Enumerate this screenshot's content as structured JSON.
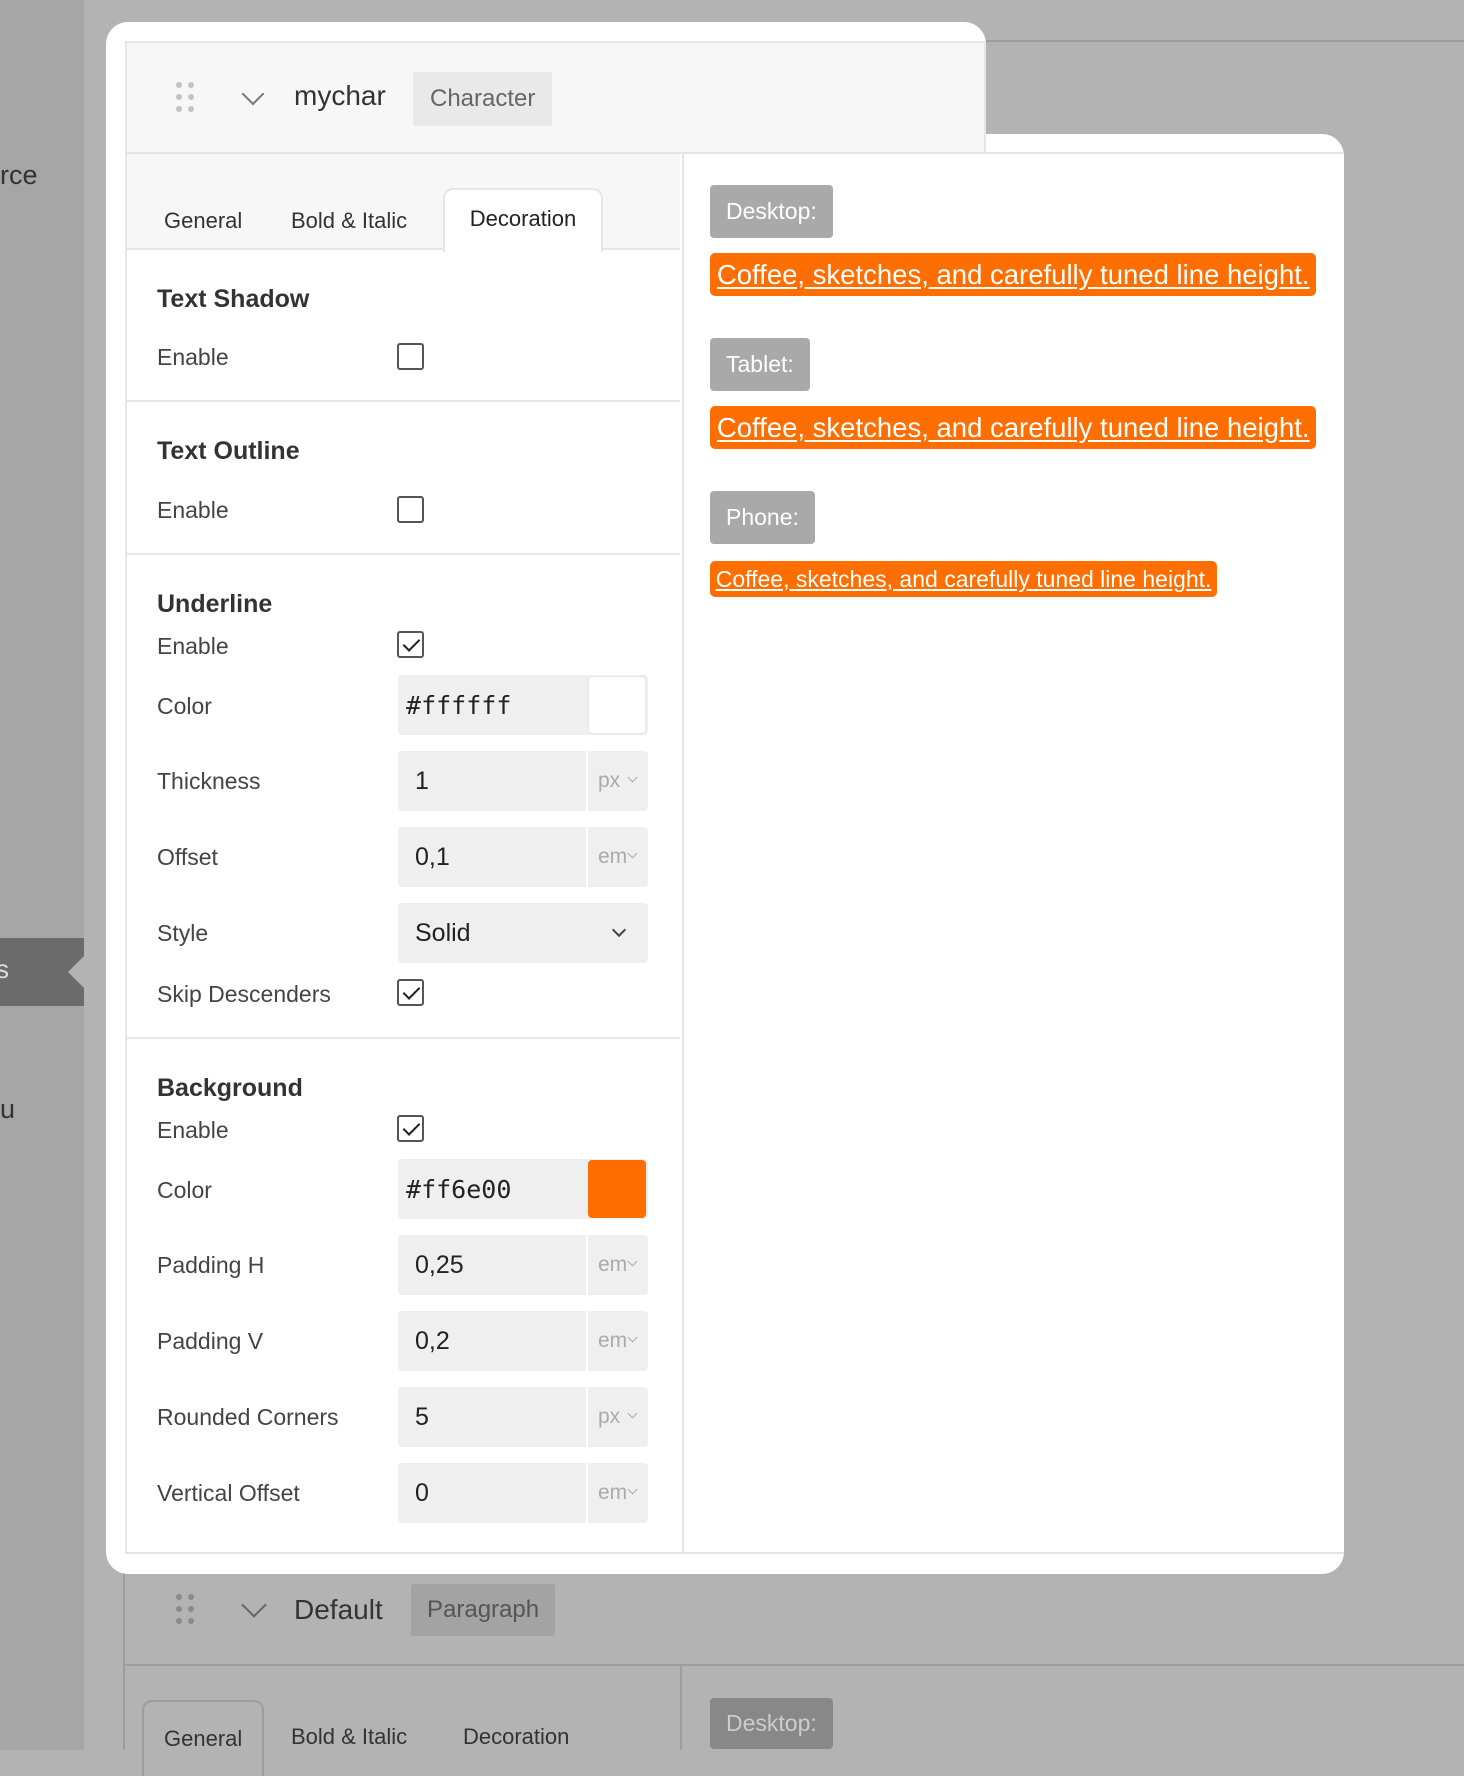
{
  "background_page": {
    "sidebar_fragments": [
      "rce",
      "s",
      "u"
    ],
    "next_item": {
      "title": "Default",
      "badge": "Paragraph"
    },
    "next_tabs": [
      "General",
      "Bold & Italic",
      "Decoration"
    ],
    "next_device_label": "Desktop:"
  },
  "style_item": {
    "title": "mychar",
    "badge": "Character"
  },
  "tabs": [
    "General",
    "Bold & Italic",
    "Decoration"
  ],
  "active_tab": "Decoration",
  "text_shadow": {
    "title": "Text Shadow",
    "enable_label": "Enable",
    "enabled": false
  },
  "text_outline": {
    "title": "Text Outline",
    "enable_label": "Enable",
    "enabled": false
  },
  "underline": {
    "title": "Underline",
    "enable_label": "Enable",
    "enabled": true,
    "color_label": "Color",
    "color_value": "ffffff",
    "color_hex": "#ffffff",
    "thickness_label": "Thickness",
    "thickness_value": "1",
    "thickness_unit": "px",
    "offset_label": "Offset",
    "offset_value": "0,1",
    "offset_unit": "em",
    "style_label": "Style",
    "style_value": "Solid",
    "skip_label": "Skip Descenders",
    "skip_enabled": true
  },
  "background": {
    "title": "Background",
    "enable_label": "Enable",
    "enabled": true,
    "color_label": "Color",
    "color_value": "ff6e00",
    "color_hex": "#ff6e00",
    "padding_h_label": "Padding H",
    "padding_h_value": "0,25",
    "padding_h_unit": "em",
    "padding_v_label": "Padding V",
    "padding_v_value": "0,2",
    "padding_v_unit": "em",
    "corners_label": "Rounded Corners",
    "corners_value": "5",
    "corners_unit": "px",
    "voffset_label": "Vertical Offset",
    "voffset_value": "0",
    "voffset_unit": "em"
  },
  "preview": {
    "desktop_label": "Desktop:",
    "tablet_label": "Tablet:",
    "phone_label": "Phone:",
    "sample_text": "Coffee, sketches, and carefully tuned line height."
  },
  "hash_symbol": "#"
}
